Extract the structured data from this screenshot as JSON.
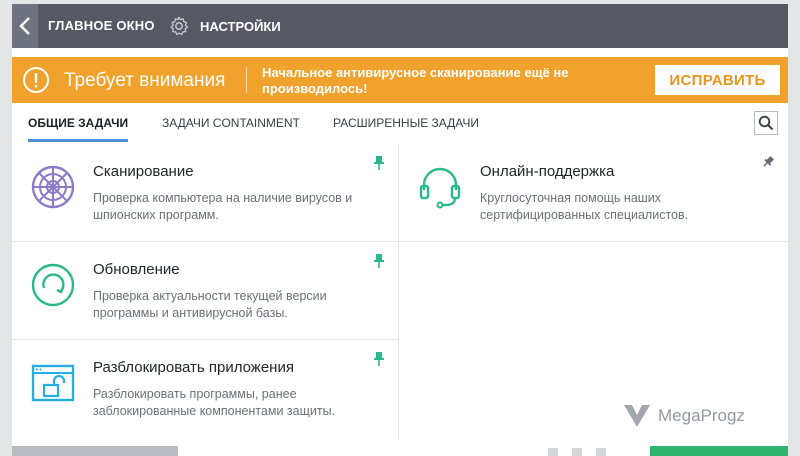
{
  "header": {
    "main_window_label": "ГЛАВНОЕ ОКНО",
    "settings_label": "НАСТРОЙКИ"
  },
  "alert": {
    "title": "Требует внимания",
    "message": "Начальное антивирусное сканирование ещё не производилось!",
    "fix_label": "ИСПРАВИТЬ",
    "color": "#f1a22d"
  },
  "tabs": [
    {
      "label": "ОБЩИЕ ЗАДАЧИ",
      "active": true
    },
    {
      "label": "ЗАДАЧИ CONTAINMENT",
      "active": false
    },
    {
      "label": "РАСШИРЕННЫЕ ЗАДАЧИ",
      "active": false
    }
  ],
  "tasks": [
    {
      "title": "Сканирование",
      "description": "Проверка компьютера на наличие вирусов и шпионских программ.",
      "icon": "radar-icon",
      "color": "#8a7cc6"
    },
    {
      "title": "Онлайн-поддержка",
      "description": "Круглосуточная помощь наших сертифицированных специалистов.",
      "icon": "headset-icon",
      "color": "#2bb88a"
    },
    {
      "title": "Обновление",
      "description": "Проверка актуальности текущей версии программы и антивирусной базы.",
      "icon": "refresh-icon",
      "color": "#2bb88a"
    },
    {
      "title": "Разблокировать приложения",
      "description": "Разблокировать программы, ранее заблокированные компонентами защиты.",
      "icon": "unlock-window-icon",
      "color": "#25aee0"
    }
  ],
  "watermark": {
    "text": "MegaProgz"
  }
}
